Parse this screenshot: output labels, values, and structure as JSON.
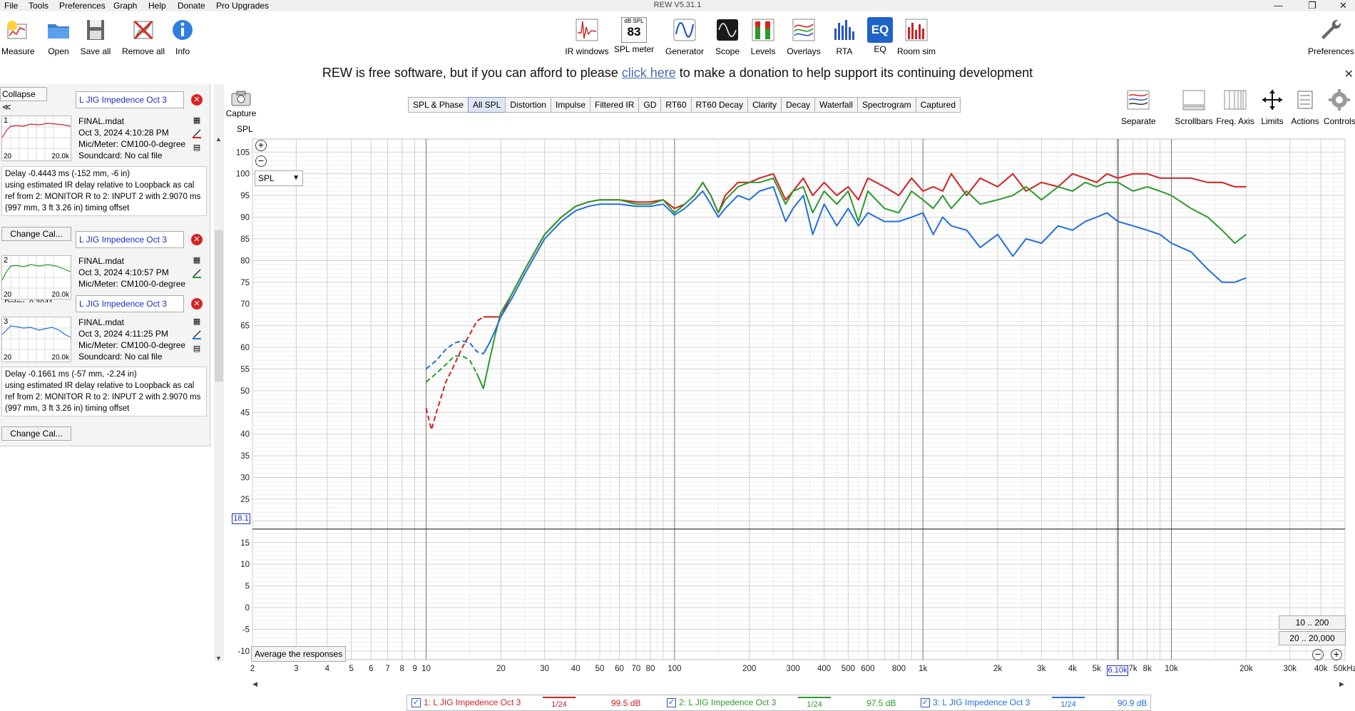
{
  "window": {
    "title": "REW V5.31.1",
    "minimize": "—",
    "maximize": "❐",
    "close": "✕"
  },
  "menu": [
    "File",
    "Tools",
    "Preferences",
    "Graph",
    "Help",
    "Donate",
    "Pro Upgrades"
  ],
  "toolbar_left": [
    {
      "label": "Measure",
      "icon": "measure-icon"
    },
    {
      "label": "Open",
      "icon": "folder-icon"
    },
    {
      "label": "Save all",
      "icon": "save-icon"
    },
    {
      "label": "Remove all",
      "icon": "remove-icon"
    },
    {
      "label": "Info",
      "icon": "info-icon"
    }
  ],
  "toolbar_center": [
    {
      "label": "IR windows",
      "icon": "ir-windows-icon"
    },
    {
      "label": "SPL meter",
      "icon": "spl-meter-icon",
      "badge_top": "dB SPL",
      "badge_value": "83"
    },
    {
      "label": "Generator",
      "icon": "generator-icon"
    },
    {
      "label": "Scope",
      "icon": "scope-icon"
    },
    {
      "label": "Levels",
      "icon": "levels-icon"
    },
    {
      "label": "Overlays",
      "icon": "overlays-icon"
    },
    {
      "label": "RTA",
      "icon": "rta-icon"
    },
    {
      "label": "EQ",
      "icon": "eq-icon",
      "badge_value": "EQ"
    },
    {
      "label": "Room sim",
      "icon": "room-sim-icon"
    }
  ],
  "toolbar_right": {
    "label": "Preferences",
    "icon": "wrench-icon"
  },
  "donate_banner": {
    "before": "REW is free software, but if you can afford to please ",
    "link": "click here",
    "after": " to make a donation to help support its continuing development",
    "close": "✕"
  },
  "left_panel": {
    "collapse_label": "Collapse ≪",
    "change_cal": "Change Cal...",
    "measurements": [
      {
        "index": "1",
        "name": "L JIG Impedence Oct 3",
        "file": "FINAL.mdat",
        "date": "Oct 3, 2024 4:10:28 PM",
        "mic": "Mic/Meter: CM100-0-degree",
        "card": "Soundcard: No cal file",
        "thumb_min": "20",
        "thumb_max": "20.0k",
        "delay": [
          "Delay -0.4443 ms (-152 mm, -6 in)",
          "using estimated IR delay relative to Loopback as cal",
          "ref from 2: MONITOR R to 2: INPUT 2 with 2.9070 ms",
          "(997 mm, 3 ft 3.26 in) timing offset"
        ],
        "color": "#d41f1f"
      },
      {
        "index": "2",
        "name": "L JIG Impedence Oct 3",
        "file": "FINAL.mdat",
        "date": "Oct 3, 2024 4:10:57 PM",
        "mic": "Mic/Meter: CM100-0-degree",
        "thumb_min": "20",
        "thumb_max": "20.0k",
        "delay_partial": "Delay -0.3041",
        "color": "#2a9a2a"
      },
      {
        "index": "3",
        "name": "L JIG Impedence Oct 3",
        "file": "FINAL.mdat",
        "date": "Oct 3, 2024 4:11:25 PM",
        "mic": "Mic/Meter: CM100-0-degree",
        "card": "Soundcard: No cal file",
        "thumb_min": "20",
        "thumb_max": "20.0k",
        "delay": [
          "Delay -0.1661 ms (-57 mm, -2.24 in)",
          "using estimated IR delay relative to Loopback as cal",
          "ref from 2: MONITOR R to 2: INPUT 2 with 2.9070 ms",
          "(997 mm, 3 ft 3.26 in) timing offset"
        ],
        "color": "#1f6fe0"
      }
    ]
  },
  "graph_toolbar": {
    "capture": "Capture",
    "tabs": [
      "SPL & Phase",
      "All SPL",
      "Distortion",
      "Impulse",
      "Filtered IR",
      "GD",
      "RT60",
      "RT60 Decay",
      "Clarity",
      "Decay",
      "Waterfall",
      "Spectrogram",
      "Captured"
    ],
    "active_tab": "All SPL",
    "right_buttons": [
      {
        "label": "Separate",
        "icon": "separate-icon"
      },
      {
        "label": "Scrollbars",
        "icon": "scrollbars-icon"
      },
      {
        "label": "Freq. Axis",
        "icon": "freq-axis-icon"
      },
      {
        "label": "Limits",
        "icon": "limits-icon"
      },
      {
        "label": "Actions",
        "icon": "actions-icon"
      },
      {
        "label": "Controls",
        "icon": "controls-icon"
      }
    ]
  },
  "graph_controls": {
    "spl_select": "SPL",
    "average_button": "Average the responses",
    "range_buttons": [
      "10 .. 200",
      "20 .. 20,000"
    ],
    "cursor_y": "18.1",
    "cursor_x": "6.10k"
  },
  "chart_data": {
    "type": "line",
    "ylabel": "SPL",
    "xunit": "Hz",
    "x_scale": "log",
    "xlim": [
      2,
      50000
    ],
    "ylim": [
      -12,
      108
    ],
    "y_ticks": [
      105,
      100,
      95,
      90,
      85,
      80,
      75,
      70,
      65,
      60,
      55,
      50,
      45,
      40,
      35,
      30,
      25,
      20,
      15,
      10,
      5,
      0,
      -5,
      -10
    ],
    "x_ticks": [
      {
        "v": 2,
        "l": "2"
      },
      {
        "v": 3,
        "l": "3"
      },
      {
        "v": 4,
        "l": "4"
      },
      {
        "v": 5,
        "l": "5"
      },
      {
        "v": 6,
        "l": "6"
      },
      {
        "v": 7,
        "l": "7"
      },
      {
        "v": 8,
        "l": "8"
      },
      {
        "v": 9,
        "l": "9"
      },
      {
        "v": 10,
        "l": "10"
      },
      {
        "v": 20,
        "l": "20"
      },
      {
        "v": 30,
        "l": "30"
      },
      {
        "v": 40,
        "l": "40"
      },
      {
        "v": 50,
        "l": "50"
      },
      {
        "v": 60,
        "l": "60"
      },
      {
        "v": 70,
        "l": "70"
      },
      {
        "v": 80,
        "l": "80"
      },
      {
        "v": 100,
        "l": "100"
      },
      {
        "v": 200,
        "l": "200"
      },
      {
        "v": 300,
        "l": "300"
      },
      {
        "v": 400,
        "l": "400"
      },
      {
        "v": 500,
        "l": "500"
      },
      {
        "v": 600,
        "l": "600"
      },
      {
        "v": 800,
        "l": "800"
      },
      {
        "v": 1000,
        "l": "1k"
      },
      {
        "v": 2000,
        "l": "2k"
      },
      {
        "v": 3000,
        "l": "3k"
      },
      {
        "v": 4000,
        "l": "4k"
      },
      {
        "v": 5000,
        "l": "5k"
      },
      {
        "v": 7000,
        "l": "7k"
      },
      {
        "v": 8000,
        "l": "8k"
      },
      {
        "v": 10000,
        "l": "10k"
      },
      {
        "v": 20000,
        "l": "20k"
      },
      {
        "v": 30000,
        "l": "30k"
      },
      {
        "v": 40000,
        "l": "40k"
      },
      {
        "v": 50000,
        "l": "50kHz"
      }
    ],
    "cursor": {
      "x": 6100,
      "y": 18.1
    },
    "grid": true,
    "series": [
      {
        "name": "1: L JIG Impedence Oct 3",
        "color": "#d41f1f",
        "dashed_until": 17,
        "x": [
          10,
          10.5,
          11,
          12,
          13,
          14,
          15,
          16,
          17,
          18,
          19,
          20,
          22,
          25,
          30,
          35,
          40,
          45,
          50,
          60,
          70,
          80,
          90,
          100,
          110,
          120,
          130,
          140,
          150,
          160,
          180,
          200,
          220,
          250,
          280,
          300,
          330,
          360,
          400,
          450,
          500,
          550,
          600,
          700,
          800,
          900,
          1000,
          1100,
          1200,
          1300,
          1500,
          1700,
          2000,
          2300,
          2600,
          3000,
          3500,
          4000,
          4500,
          5000,
          5500,
          6100,
          7000,
          8000,
          9000,
          10000,
          12000,
          14000,
          16000,
          18000,
          20000
        ],
        "y": [
          46,
          41,
          45,
          52,
          56,
          60,
          63,
          66,
          67,
          67,
          67,
          67,
          72,
          78,
          86,
          90,
          92.5,
          93.5,
          94,
          94,
          93.5,
          93.5,
          94,
          92,
          93,
          95,
          98,
          95,
          91,
          95,
          98,
          98,
          99,
          100,
          94,
          96,
          99,
          95,
          98,
          95,
          97,
          94,
          99,
          97,
          95,
          99,
          96,
          97,
          96,
          100,
          95,
          99,
          97,
          100,
          96,
          98,
          97,
          100,
          99,
          98,
          100,
          99,
          100,
          100,
          99,
          99,
          99,
          98,
          98,
          97,
          97
        ]
      },
      {
        "name": "2: L JIG Impedence Oct 3",
        "color": "#2a9a2a",
        "dashed_until": 16,
        "x": [
          10,
          11,
          12,
          13,
          14,
          15,
          16,
          17,
          18,
          19,
          20,
          22,
          25,
          30,
          35,
          40,
          45,
          50,
          60,
          70,
          80,
          90,
          100,
          110,
          120,
          130,
          140,
          150,
          160,
          180,
          200,
          220,
          250,
          280,
          300,
          330,
          360,
          400,
          450,
          500,
          550,
          600,
          700,
          800,
          900,
          1000,
          1100,
          1200,
          1300,
          1500,
          1700,
          2000,
          2300,
          2600,
          3000,
          3500,
          4000,
          4500,
          5000,
          5500,
          6100,
          7000,
          8000,
          9000,
          10000,
          12000,
          14000,
          16000,
          18000,
          20000
        ],
        "y": [
          52,
          54,
          56,
          58,
          58,
          57,
          54,
          50.5,
          57,
          63,
          68,
          72,
          78,
          86,
          90,
          92.5,
          93.5,
          94,
          94,
          93,
          93,
          94,
          91,
          93,
          95,
          98,
          95,
          91,
          94,
          97,
          98,
          98,
          99,
          93,
          96,
          97,
          91,
          96,
          93,
          96,
          89,
          96,
          92,
          91,
          96,
          94,
          92,
          95,
          92,
          96,
          93,
          94,
          95,
          97,
          94,
          97,
          96,
          98,
          97,
          98,
          98,
          96,
          97,
          96,
          95,
          92,
          90,
          87,
          84,
          86
        ]
      },
      {
        "name": "3: L JIG Impedence Oct 3",
        "color": "#1f6fe0",
        "dashed_until": 17,
        "x": [
          10,
          11,
          12,
          13,
          14,
          15,
          16,
          17,
          18,
          19,
          20,
          22,
          25,
          30,
          35,
          40,
          45,
          50,
          60,
          70,
          80,
          90,
          100,
          110,
          120,
          130,
          140,
          150,
          160,
          180,
          200,
          220,
          250,
          280,
          300,
          330,
          360,
          400,
          450,
          500,
          550,
          600,
          700,
          800,
          900,
          1000,
          1100,
          1200,
          1300,
          1500,
          1700,
          2000,
          2300,
          2600,
          3000,
          3500,
          4000,
          4500,
          5000,
          5500,
          6100,
          7000,
          8000,
          9000,
          10000,
          12000,
          14000,
          16000,
          18000,
          20000
        ],
        "y": [
          55,
          57,
          59.5,
          61,
          61.5,
          61,
          59,
          58.5,
          61,
          64,
          67,
          71,
          77,
          85,
          89,
          91.5,
          92.5,
          93,
          93,
          92.5,
          92.5,
          93,
          90.5,
          92,
          94,
          96,
          93,
          90,
          92,
          95,
          94,
          96,
          97,
          89,
          92,
          95,
          86,
          93,
          88,
          92,
          88,
          91,
          89,
          89,
          90,
          91,
          86,
          90,
          88,
          87,
          83,
          86,
          81,
          85,
          84,
          88,
          87,
          89,
          90,
          91,
          89,
          88,
          87,
          86,
          84,
          82,
          78,
          75,
          75,
          76
        ]
      }
    ]
  },
  "legend": {
    "check": "✓",
    "smoothing": "1/24",
    "items": [
      {
        "name": "1: L JIG Impedence Oct 3",
        "value": "99.5 dB",
        "color": "#d41f1f"
      },
      {
        "name": "2: L JIG Impedence Oct 3",
        "value": "97.5 dB",
        "color": "#2a9a2a"
      },
      {
        "name": "3: L JIG Impedence Oct 3",
        "value": "90.9 dB",
        "color": "#1f6fe0"
      }
    ]
  }
}
